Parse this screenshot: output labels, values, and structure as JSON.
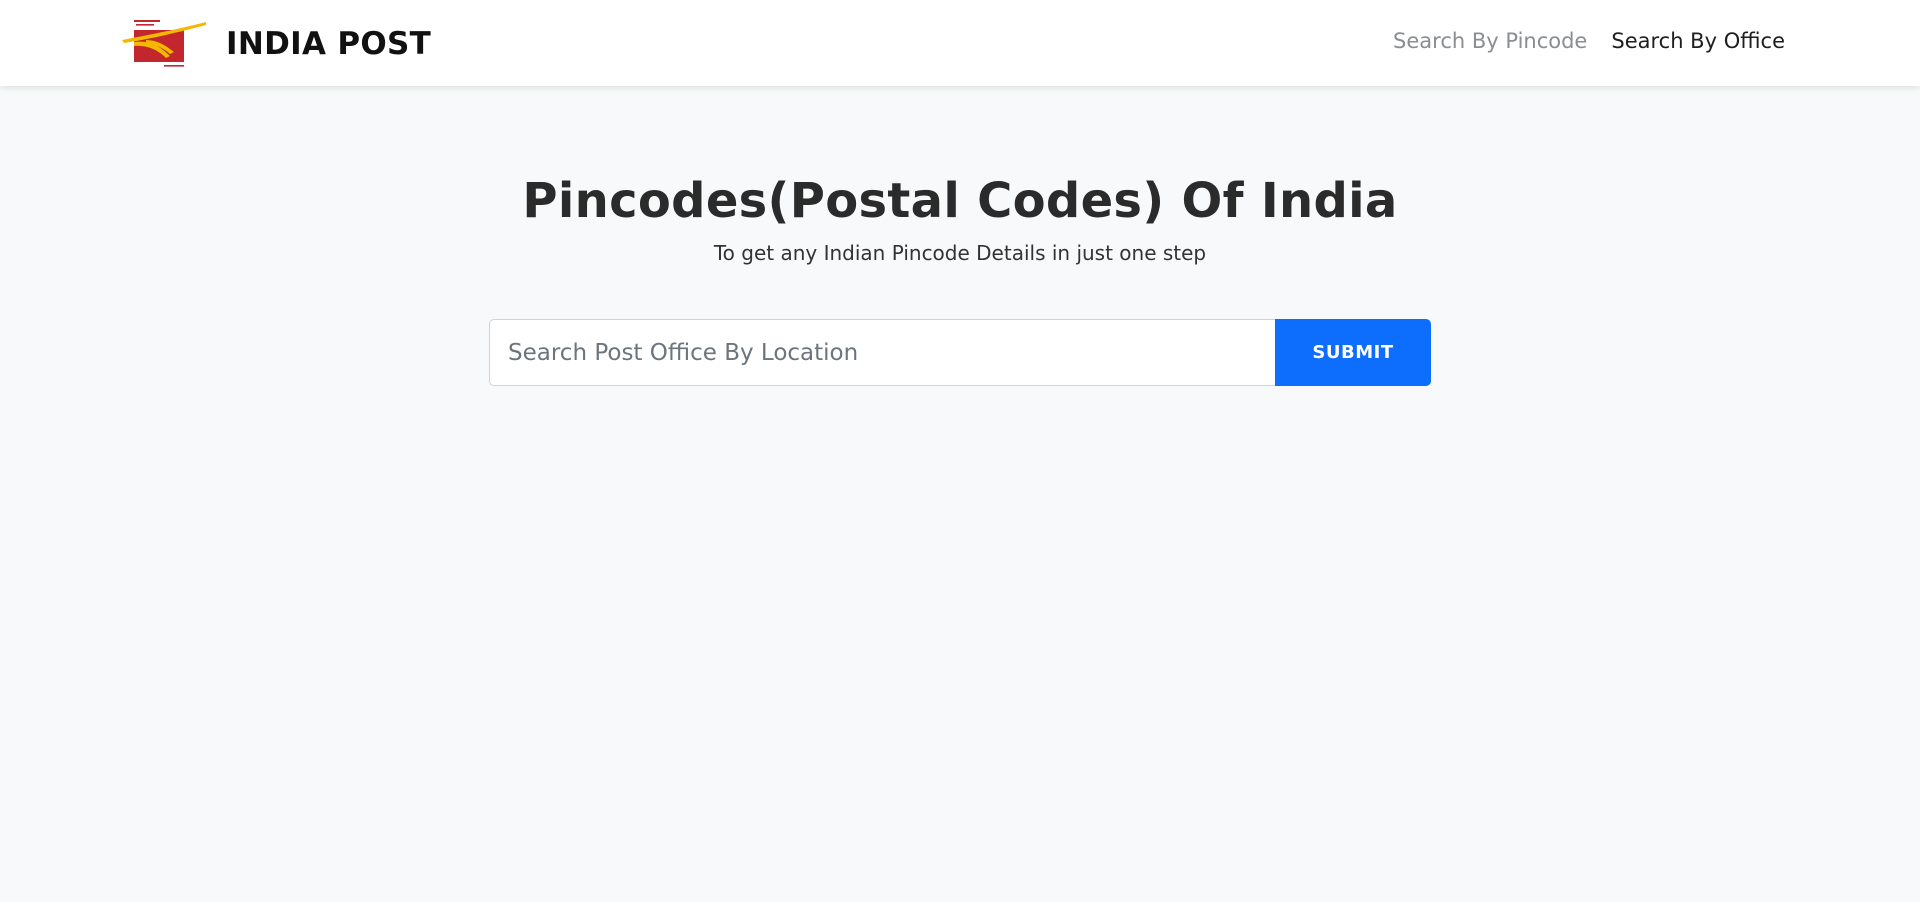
{
  "navbar": {
    "logo_icon": "india-post-logo-icon",
    "brand_name": "INDIA POST",
    "links": [
      {
        "label": "Search By Pincode",
        "state": "muted"
      },
      {
        "label": "Search By Office",
        "state": "active"
      }
    ]
  },
  "hero": {
    "title": "Pincodes(Postal Codes) Of India",
    "subtitle": "To get any Indian Pincode Details in just one step"
  },
  "search": {
    "placeholder": "Search Post Office By Location",
    "value": "",
    "submit_label": "SUBMIT"
  },
  "colors": {
    "background": "#f8f9fa",
    "navbar": "#ffffff",
    "primary": "#0d6efd",
    "logo_red": "#c1272d",
    "logo_yellow": "#f5b800"
  }
}
